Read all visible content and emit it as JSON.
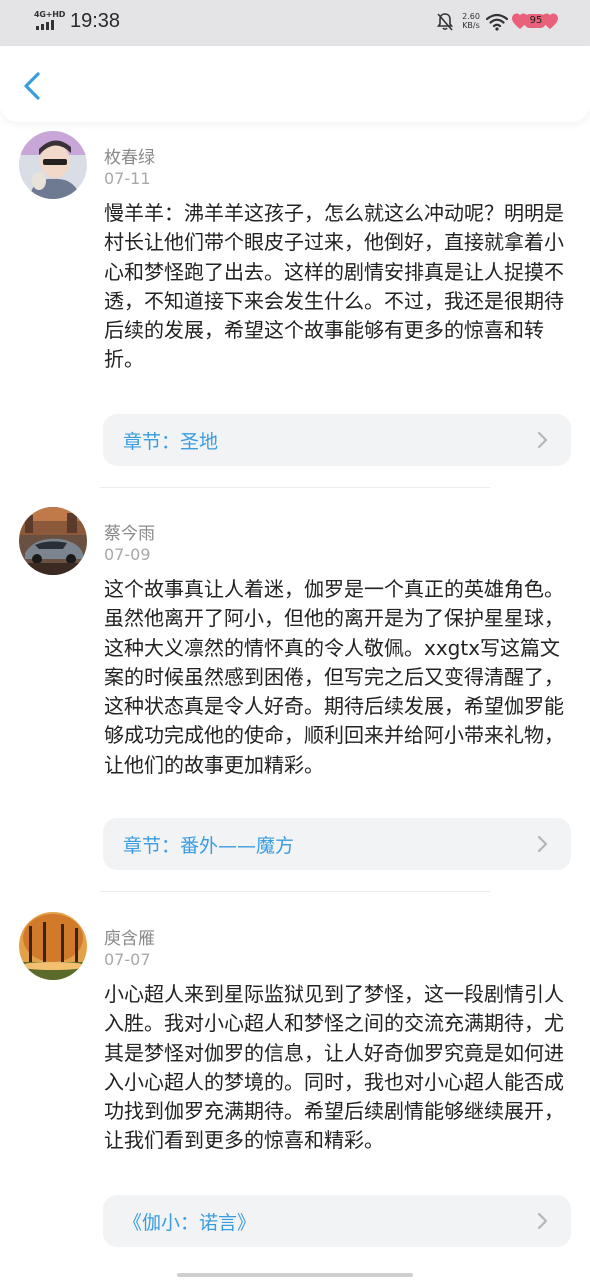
{
  "status_bar": {
    "network": "4G+HD",
    "time": "19:38",
    "speed_value": "2.60",
    "speed_unit": "KB/s",
    "battery": "95"
  },
  "header": {
    "back_icon": "chevron-left-icon"
  },
  "comments": [
    {
      "username": "枚春绿",
      "date": "07-11",
      "text": "慢羊羊：沸羊羊这孩子，怎么就这么冲动呢？明明是村长让他们带个眼皮子过来，他倒好，直接就拿着小心和梦怪跑了出去。这样的剧情安排真是让人捉摸不透，不知道接下来会发生什么。不过，我还是很期待后续的发展，希望这个故事能够有更多的惊喜和转折。",
      "chapter": "章节：圣地"
    },
    {
      "username": "蔡今雨",
      "date": "07-09",
      "text": "这个故事真让人着迷，伽罗是一个真正的英雄角色。虽然他离开了阿小，但他的离开是为了保护星星球，这种大义凛然的情怀真的令人敬佩。xxgtx写这篇文案的时候虽然感到困倦，但写完之后又变得清醒了，这种状态真是令人好奇。期待后续发展，希望伽罗能够成功完成他的使命，顺利回来并给阿小带来礼物，让他们的故事更加精彩。",
      "chapter": "章节：番外——魔方"
    },
    {
      "username": "庾含雁",
      "date": "07-07",
      "text": "小心超人来到星际监狱见到了梦怪，这一段剧情引人入胜。我对小心超人和梦怪之间的交流充满期待，尤其是梦怪对伽罗的信息，让人好奇伽罗究竟是如何进入小心超人的梦境的。同时，我也对小心超人能否成功找到伽罗充满期待。希望后续剧情能够继续展开，让我们看到更多的惊喜和精彩。",
      "chapter": "《伽小：诺言》"
    }
  ],
  "colors": {
    "accent": "#3a9de0",
    "status_bar_bg": "#e4e4e6",
    "chapter_bg": "#f2f3f5",
    "battery_fill": "#e8607a"
  }
}
